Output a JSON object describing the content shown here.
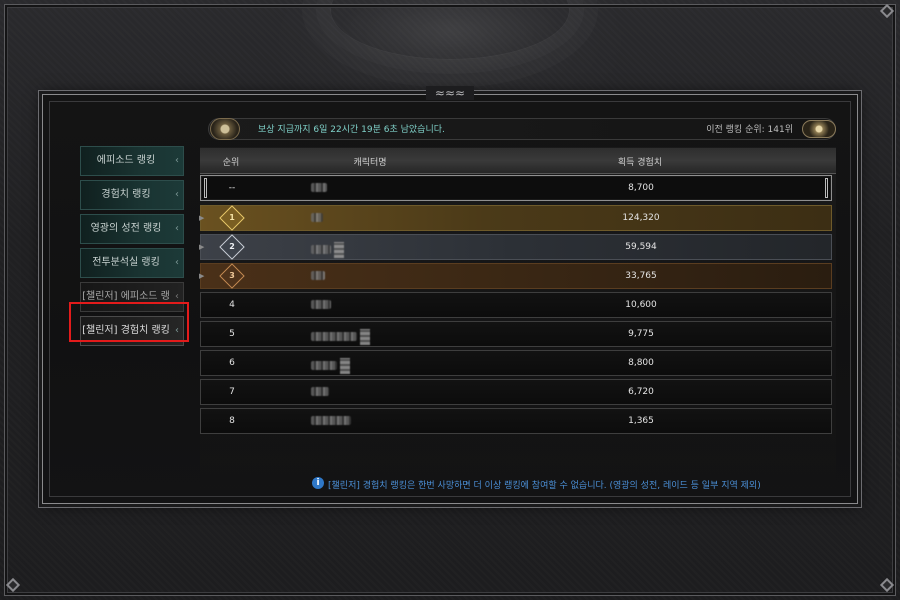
{
  "sidebar": {
    "items": [
      {
        "label": "에피소드 랭킹",
        "style": "teal"
      },
      {
        "label": "경험치 랭킹",
        "style": "teal"
      },
      {
        "label": "영광의 성전 랭킹",
        "style": "teal"
      },
      {
        "label": "전투분석실 랭킹",
        "style": "teal"
      },
      {
        "label": "[챌린저] 에피소드 랭킹",
        "style": "plain"
      },
      {
        "label": "[챌린저] 경험치 랭킹",
        "style": "active"
      }
    ],
    "arrow_glyph": "‹"
  },
  "top_bar": {
    "reward_timer": "보상 지급까지 6일 22시간 19분 6초 남았습니다.",
    "previous_rank": "이전 랭킹 순위: 141위",
    "chest_icon": "treasure-chest-icon",
    "trophy_icon": "trophy-icon"
  },
  "table": {
    "headers": {
      "rank": "순위",
      "name": "캐릭터명",
      "exp": "획득 경험치"
    },
    "my_row": {
      "rank": "--",
      "exp": "8,700"
    },
    "rows": [
      {
        "rank": "1",
        "exp": "124,320",
        "tier": "gold"
      },
      {
        "rank": "2",
        "exp": "59,594",
        "tier": "silver"
      },
      {
        "rank": "3",
        "exp": "33,765",
        "tier": "bronze"
      },
      {
        "rank": "4",
        "exp": "10,600",
        "tier": "normal"
      },
      {
        "rank": "5",
        "exp": "9,775",
        "tier": "normal"
      },
      {
        "rank": "6",
        "exp": "8,800",
        "tier": "normal"
      },
      {
        "rank": "7",
        "exp": "6,720",
        "tier": "normal"
      },
      {
        "rank": "8",
        "exp": "1,365",
        "tier": "normal"
      }
    ]
  },
  "notice": {
    "icon": "info-icon",
    "icon_glyph": "i",
    "text": "[챌린저] 경험치 랭킹은 한번 사망하면 더 이상 랭킹에 참여할 수 없습니다. (영광의 성전, 레이드 등 일부 지역 제외)"
  },
  "colors": {
    "highlight": "#e31b1b",
    "timer_text": "#7fd0c8",
    "notice_text": "#4b8fd6",
    "gold": "#6a5120",
    "silver": "#3d4148",
    "bronze": "#4a3018"
  },
  "ornament_glyph": "≈≈≈"
}
